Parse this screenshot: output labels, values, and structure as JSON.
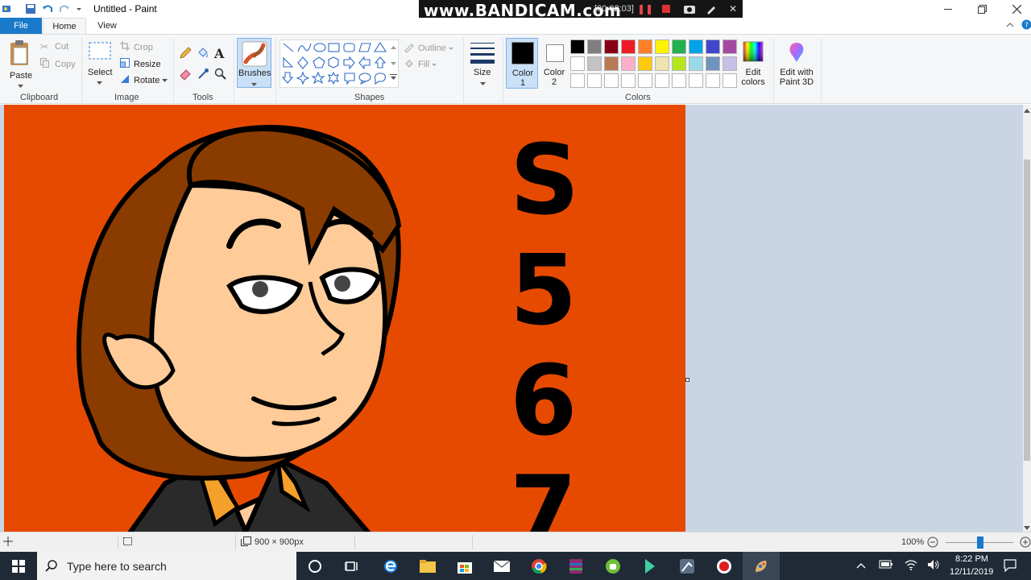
{
  "window": {
    "title": "Untitled - Paint"
  },
  "recorder": {
    "brand": "www.BANDICAM.com",
    "time": "[00:02:03]"
  },
  "tabs": {
    "file": "File",
    "home": "Home",
    "view": "View"
  },
  "ribbon": {
    "clipboard": {
      "paste": "Paste",
      "cut": "Cut",
      "copy": "Copy",
      "label": "Clipboard"
    },
    "image": {
      "select": "Select",
      "crop": "Crop",
      "resize": "Resize",
      "rotate": "Rotate",
      "label": "Image"
    },
    "tools": {
      "label": "Tools"
    },
    "brushes": {
      "label": "Brushes"
    },
    "shapes": {
      "outline": "Outline",
      "fill": "Fill",
      "label": "Shapes"
    },
    "size": {
      "label": "Size"
    },
    "color1": {
      "label": "Color",
      "num": "1",
      "value": "#000000"
    },
    "color2": {
      "label": "Color",
      "num": "2",
      "value": "#ffffff"
    },
    "colors": {
      "label": "Colors"
    },
    "edit_colors": {
      "line1": "Edit",
      "line2": "colors"
    },
    "paint3d": {
      "line1": "Edit with",
      "line2": "Paint 3D"
    },
    "palette_row1": [
      "#000000",
      "#7f7f7f",
      "#880015",
      "#ed1c24",
      "#ff7f27",
      "#fff200",
      "#22b14c",
      "#00a2e8",
      "#3f48cc",
      "#a349a4"
    ],
    "palette_row2": [
      "#ffffff",
      "#c3c3c3",
      "#b97a57",
      "#ffaec9",
      "#ffc90e",
      "#efe4b0",
      "#b5e61d",
      "#99d9ea",
      "#7092be",
      "#c8bfe7"
    ],
    "palette_row3": [
      "#ffffff",
      "#ffffff",
      "#ffffff",
      "#ffffff",
      "#ffffff",
      "#ffffff",
      "#ffffff",
      "#ffffff",
      "#ffffff",
      "#ffffff"
    ]
  },
  "canvas": {
    "background": "#e64a00",
    "characters": [
      "S",
      "5",
      "6",
      "7"
    ]
  },
  "status": {
    "image_size": "900 × 900px",
    "zoom": "100%"
  },
  "taskbar": {
    "search_placeholder": "Type here to search",
    "time": "8:22 PM",
    "date": "12/11/2019"
  }
}
